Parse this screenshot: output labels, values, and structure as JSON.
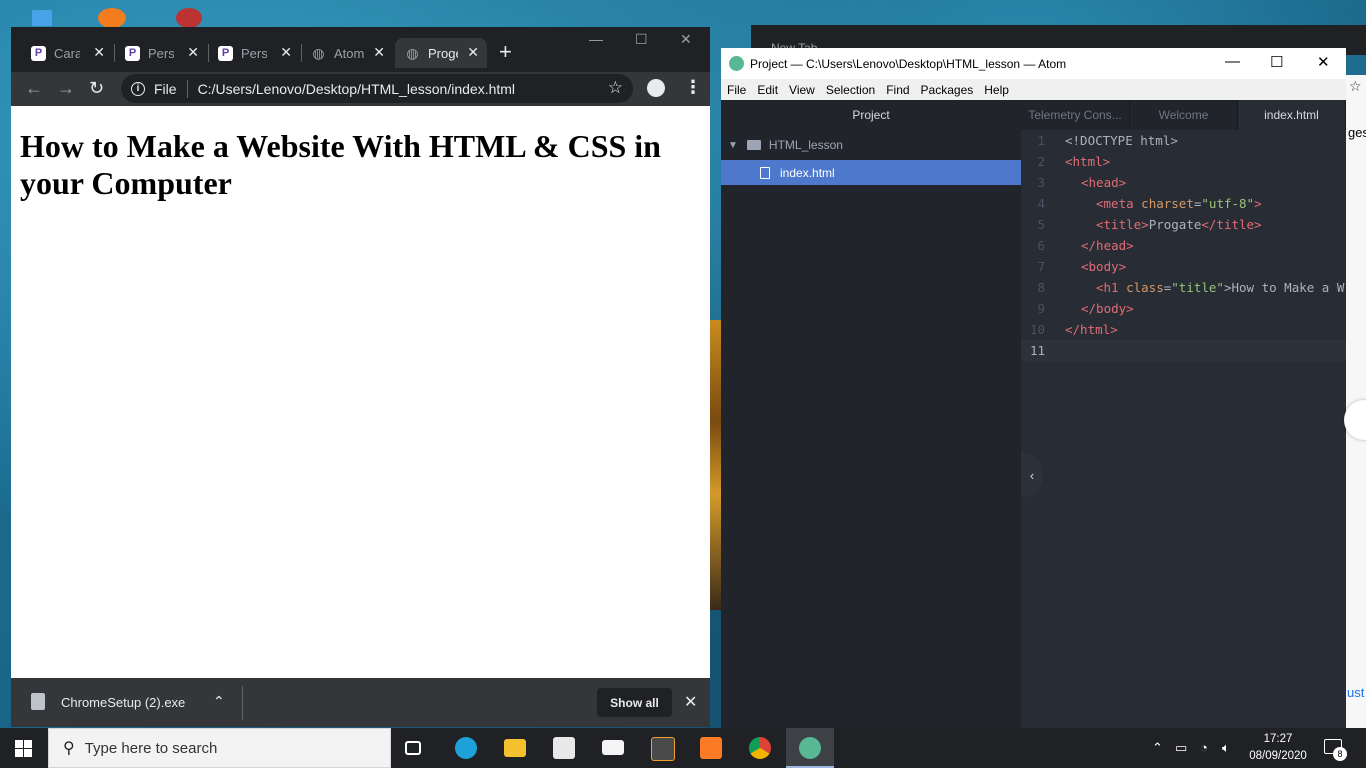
{
  "chrome": {
    "tabs": [
      {
        "label": "Cara M",
        "favicon": "progate-icon",
        "active": false
      },
      {
        "label": "Persia",
        "favicon": "progate-icon",
        "active": false
      },
      {
        "label": "Persia",
        "favicon": "progate-icon",
        "active": false
      },
      {
        "label": "Atom",
        "favicon": "globe-icon",
        "active": false
      },
      {
        "label": "Proge",
        "favicon": "globe-icon",
        "active": true
      }
    ],
    "omnibox": {
      "scheme": "File",
      "url": "C:/Users/Lenovo/Desktop/HTML_lesson/index.html"
    },
    "page": {
      "heading": "How to Make a Website With HTML & CSS in your Computer"
    },
    "downloads": {
      "filename": "ChromeSetup (2).exe",
      "show_all": "Show all"
    }
  },
  "background_tab": {
    "label": "New Tab"
  },
  "atom": {
    "title": "Project — C:\\Users\\Lenovo\\Desktop\\HTML_lesson — Atom",
    "menu": [
      "File",
      "Edit",
      "View",
      "Selection",
      "Find",
      "Packages",
      "Help"
    ],
    "tree": {
      "header": "Project",
      "folder": "HTML_lesson",
      "file": "index.html"
    },
    "tabs": [
      {
        "label": "Telemetry Cons...",
        "active": false
      },
      {
        "label": "Welcome",
        "active": false
      },
      {
        "label": "index.html",
        "active": true
      }
    ],
    "code_lines": [
      {
        "n": "1"
      },
      {
        "n": "2"
      },
      {
        "n": "3"
      },
      {
        "n": "4"
      },
      {
        "n": "5"
      },
      {
        "n": "6"
      },
      {
        "n": "7"
      },
      {
        "n": "8"
      },
      {
        "n": "9"
      },
      {
        "n": "10"
      },
      {
        "n": "11"
      }
    ],
    "code": {
      "doctype": "<!DOCTYPE html>",
      "html_open": "<html>",
      "head_open": "<head>",
      "meta_tag": "<meta",
      "meta_attr": "charset",
      "meta_val": "\"utf-8\"",
      "meta_end": ">",
      "title_open": "<title>",
      "title_text": "Progate",
      "title_close": "</title>",
      "head_close": "</head>",
      "body_open": "<body>",
      "h1_open": "<h1",
      "h1_attr": "class",
      "h1_val": "\"title\"",
      "h1_text": ">How to Make a W",
      "body_close": "</body>",
      "html_close": "</html>"
    }
  },
  "peek": {
    "text_top": "ges",
    "text_bottom": "ust"
  },
  "taskbar": {
    "search_placeholder": "Type here to search",
    "time": "17:27",
    "date": "08/09/2020",
    "notification_count": "8"
  },
  "colors": {
    "chrome_dark": "#202124",
    "chrome_toolbar": "#35363a",
    "atom_selected": "#4d78cc",
    "atom_editor_bg": "#282c34",
    "code_tag": "#e06c75",
    "code_attr": "#d19a66",
    "code_string": "#98c379"
  }
}
